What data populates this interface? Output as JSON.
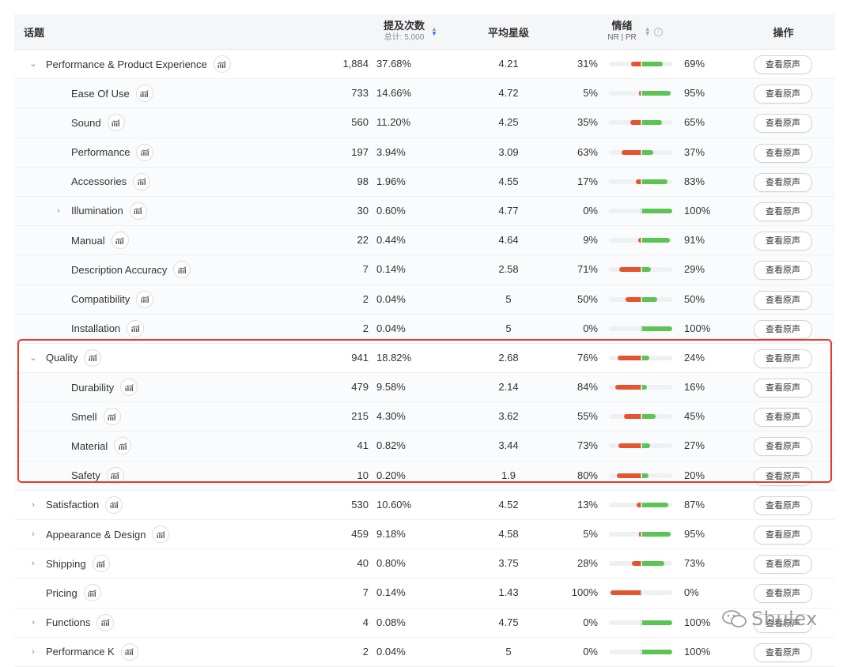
{
  "header": {
    "topic": "话题",
    "mentions": "提及次数",
    "mentions_total": "总计: 5,000",
    "rating": "平均星级",
    "sentiment": "情绪",
    "sentiment_sub": "NR | PR",
    "action": "操作"
  },
  "action_label": "查看原声",
  "rows": [
    {
      "topic": "Performance & Product Experience",
      "level": 0,
      "chevron": "down",
      "count": "1,884",
      "pct": "37.68%",
      "rating": "4.21",
      "nr": "31%",
      "pr": "69%",
      "nr_value": 31,
      "pr_value": 69
    },
    {
      "topic": "Ease Of Use",
      "level": 1,
      "chevron": "",
      "count": "733",
      "pct": "14.66%",
      "rating": "4.72",
      "nr": "5%",
      "pr": "95%",
      "nr_value": 5,
      "pr_value": 95
    },
    {
      "topic": "Sound",
      "level": 1,
      "chevron": "",
      "count": "560",
      "pct": "11.20%",
      "rating": "4.25",
      "nr": "35%",
      "pr": "65%",
      "nr_value": 35,
      "pr_value": 65
    },
    {
      "topic": "Performance",
      "level": 1,
      "chevron": "",
      "count": "197",
      "pct": "3.94%",
      "rating": "3.09",
      "nr": "63%",
      "pr": "37%",
      "nr_value": 63,
      "pr_value": 37
    },
    {
      "topic": "Accessories",
      "level": 1,
      "chevron": "",
      "count": "98",
      "pct": "1.96%",
      "rating": "4.55",
      "nr": "17%",
      "pr": "83%",
      "nr_value": 17,
      "pr_value": 83
    },
    {
      "topic": "Illumination",
      "level": 1,
      "chevron": "right",
      "count": "30",
      "pct": "0.60%",
      "rating": "4.77",
      "nr": "0%",
      "pr": "100%",
      "nr_value": 0,
      "pr_value": 100
    },
    {
      "topic": "Manual",
      "level": 1,
      "chevron": "",
      "count": "22",
      "pct": "0.44%",
      "rating": "4.64",
      "nr": "9%",
      "pr": "91%",
      "nr_value": 9,
      "pr_value": 91
    },
    {
      "topic": "Description Accuracy",
      "level": 1,
      "chevron": "",
      "count": "7",
      "pct": "0.14%",
      "rating": "2.58",
      "nr": "71%",
      "pr": "29%",
      "nr_value": 71,
      "pr_value": 29
    },
    {
      "topic": "Compatibility",
      "level": 1,
      "chevron": "",
      "count": "2",
      "pct": "0.04%",
      "rating": "5",
      "nr": "50%",
      "pr": "50%",
      "nr_value": 50,
      "pr_value": 50
    },
    {
      "topic": "Installation",
      "level": 1,
      "chevron": "",
      "count": "2",
      "pct": "0.04%",
      "rating": "5",
      "nr": "0%",
      "pr": "100%",
      "nr_value": 0,
      "pr_value": 100
    },
    {
      "topic": "Quality",
      "level": 0,
      "chevron": "down",
      "count": "941",
      "pct": "18.82%",
      "rating": "2.68",
      "nr": "76%",
      "pr": "24%",
      "nr_value": 76,
      "pr_value": 24
    },
    {
      "topic": "Durability",
      "level": 1,
      "chevron": "",
      "count": "479",
      "pct": "9.58%",
      "rating": "2.14",
      "nr": "84%",
      "pr": "16%",
      "nr_value": 84,
      "pr_value": 16
    },
    {
      "topic": "Smell",
      "level": 1,
      "chevron": "",
      "count": "215",
      "pct": "4.30%",
      "rating": "3.62",
      "nr": "55%",
      "pr": "45%",
      "nr_value": 55,
      "pr_value": 45
    },
    {
      "topic": "Material",
      "level": 1,
      "chevron": "",
      "count": "41",
      "pct": "0.82%",
      "rating": "3.44",
      "nr": "73%",
      "pr": "27%",
      "nr_value": 73,
      "pr_value": 27
    },
    {
      "topic": "Safety",
      "level": 1,
      "chevron": "",
      "count": "10",
      "pct": "0.20%",
      "rating": "1.9",
      "nr": "80%",
      "pr": "20%",
      "nr_value": 80,
      "pr_value": 20
    },
    {
      "topic": "Satisfaction",
      "level": 0,
      "chevron": "right",
      "count": "530",
      "pct": "10.60%",
      "rating": "4.52",
      "nr": "13%",
      "pr": "87%",
      "nr_value": 13,
      "pr_value": 87
    },
    {
      "topic": "Appearance & Design",
      "level": 0,
      "chevron": "right",
      "count": "459",
      "pct": "9.18%",
      "rating": "4.58",
      "nr": "5%",
      "pr": "95%",
      "nr_value": 5,
      "pr_value": 95
    },
    {
      "topic": "Shipping",
      "level": 0,
      "chevron": "right",
      "count": "40",
      "pct": "0.80%",
      "rating": "3.75",
      "nr": "28%",
      "pr": "73%",
      "nr_value": 28,
      "pr_value": 73
    },
    {
      "topic": "Pricing",
      "level": 0,
      "chevron": "",
      "count": "7",
      "pct": "0.14%",
      "rating": "1.43",
      "nr": "100%",
      "pr": "0%",
      "nr_value": 100,
      "pr_value": 0
    },
    {
      "topic": "Functions",
      "level": 0,
      "chevron": "right",
      "count": "4",
      "pct": "0.08%",
      "rating": "4.75",
      "nr": "0%",
      "pr": "100%",
      "nr_value": 0,
      "pr_value": 100
    },
    {
      "topic": "Performance K",
      "level": 0,
      "chevron": "right",
      "count": "2",
      "pct": "0.04%",
      "rating": "5",
      "nr": "0%",
      "pr": "100%",
      "nr_value": 0,
      "pr_value": 100
    }
  ],
  "colors": {
    "negative": "#e5532f",
    "positive": "#5cc453",
    "highlight": "#e53b2c",
    "sort_active": "#2f6bff"
  },
  "watermark": "Shulex",
  "icons": {
    "trend": "trend-chart-icon",
    "expand": "chevron-down-icon",
    "collapse": "chevron-right-icon",
    "info": "info-icon",
    "sort": "sort-icon"
  }
}
